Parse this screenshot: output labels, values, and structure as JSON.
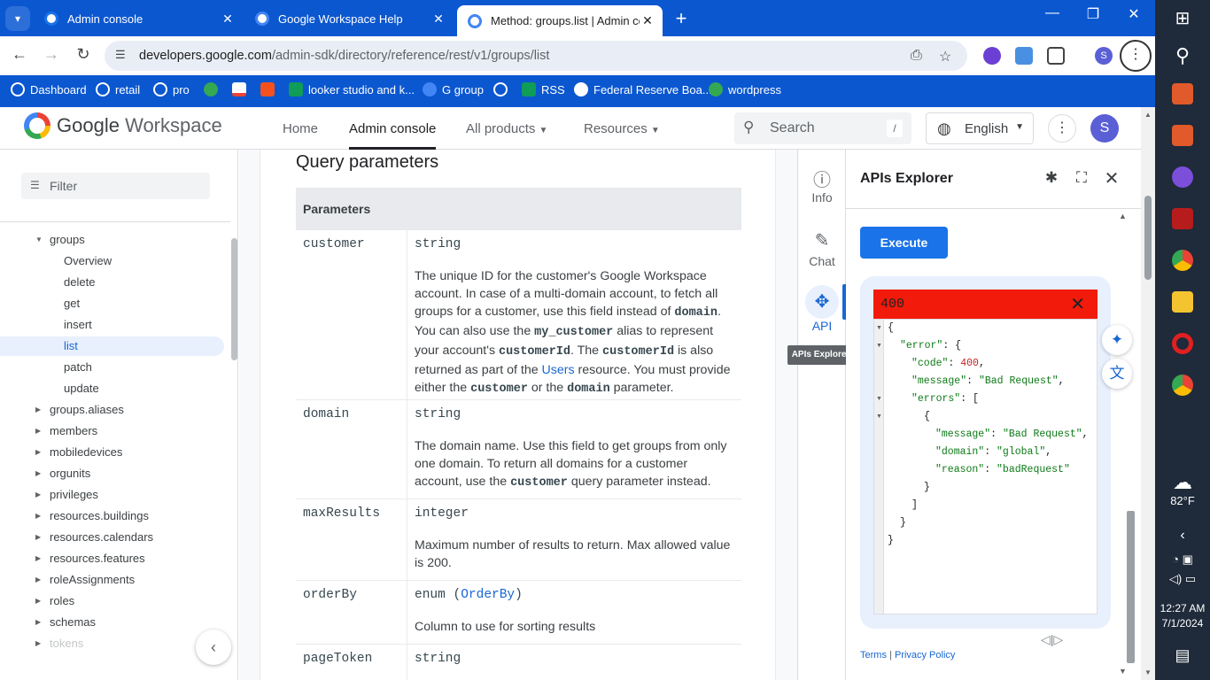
{
  "browser": {
    "tabs": [
      {
        "title": "Admin console",
        "favicon_color": "#1a73e8"
      },
      {
        "title": "Google Workspace Help",
        "favicon_color": "#4285f4"
      },
      {
        "title": "Method: groups.list  |  Admin co",
        "favicon_color": "#4285f4"
      }
    ],
    "url_domain": "developers.google.com",
    "url_path": "/admin-sdk/directory/reference/rest/v1/groups/list",
    "profile_letter": "S",
    "bookmarks": [
      {
        "label": "Dashboard",
        "color": "#ffffff"
      },
      {
        "label": "retail",
        "color": "#ffffff"
      },
      {
        "label": "pro",
        "color": "#ffffff"
      },
      {
        "label": "",
        "color": "#34a853"
      },
      {
        "label": "",
        "color": "#ea4335"
      },
      {
        "label": "",
        "color": "#f4511e"
      },
      {
        "label": "looker studio and k...",
        "color": "#0f9d58"
      },
      {
        "label": "G group",
        "color": "#4285f4"
      },
      {
        "label": "",
        "color": "#202124"
      },
      {
        "label": "RSS",
        "color": "#0f9d58"
      },
      {
        "label": "Federal Reserve Boa...",
        "color": "#ffffff"
      },
      {
        "label": "wordpress",
        "color": "#34a853"
      }
    ]
  },
  "header": {
    "logo_google": "Google",
    "logo_workspace": "Workspace",
    "nav": [
      "Home",
      "Admin console",
      "All products",
      "Resources"
    ],
    "search_placeholder": "Search",
    "search_shortcut": "/",
    "language": "English",
    "avatar_letter": "S"
  },
  "leftnav": {
    "filter_placeholder": "Filter",
    "group_label": "groups",
    "children": [
      "Overview",
      "delete",
      "get",
      "insert",
      "list",
      "patch",
      "update"
    ],
    "sections": [
      "groups.aliases",
      "members",
      "mobiledevices",
      "orgunits",
      "privileges",
      "resources.buildings",
      "resources.calendars",
      "resources.features",
      "roleAssignments",
      "roles",
      "schemas",
      "tokens"
    ]
  },
  "content": {
    "section_title": "Query parameters",
    "table_header": "Parameters",
    "params": {
      "customer": {
        "name": "customer",
        "type": "string",
        "desc": {
          "l1": "The unique ID for the customer's Google Workspace",
          "l2": "account. In case of a multi-domain account, to fetch all",
          "l3a": "groups for a customer, use this field instead of ",
          "l3code": "domain",
          "l3b": ".",
          "l4a": "You can also use the ",
          "l4code": "my_customer",
          "l4b": " alias to represent",
          "l5a": "your account's ",
          "l5code1": "customerId",
          "l5b": ". The ",
          "l5code2": "customerId",
          "l5c": " is also",
          "l6a": "returned as part of the ",
          "l6link": "Users",
          "l6b": " resource. You must provide",
          "l7a": "either the ",
          "l7code1": "customer",
          "l7b": " or the ",
          "l7code2": "domain",
          "l7c": " parameter."
        }
      },
      "domain": {
        "name": "domain",
        "type": "string",
        "desc": {
          "l1": "The domain name. Use this field to get groups from only",
          "l2": "one domain. To return all domains for a customer",
          "l3a": "account, use the ",
          "l3code": "customer",
          "l3b": " query parameter instead."
        }
      },
      "maxResults": {
        "name": "maxResults",
        "type": "integer",
        "desc": {
          "l1": "Maximum number of results to return. Max allowed value",
          "l2": "is 200."
        }
      },
      "orderBy": {
        "name": "orderBy",
        "type_prefix": "enum (",
        "type_link": "OrderBy",
        "type_suffix": ")",
        "desc": {
          "l1": "Column to use for sorting results"
        }
      },
      "pageToken": {
        "name": "pageToken",
        "type": "string"
      }
    }
  },
  "rail": {
    "info": "Info",
    "chat": "Chat",
    "api": "API",
    "tooltip": "APIs Explorer"
  },
  "explorer": {
    "title": "APIs Explorer",
    "execute": "Execute",
    "status_code": "400",
    "json": {
      "open": "{",
      "error_key": "\"error\"",
      "code_key": "\"code\"",
      "code_val": "400",
      "message_key": "\"message\"",
      "message_val": "\"Bad Request\"",
      "errors_key": "\"errors\"",
      "inner_message_key": "\"message\"",
      "inner_message_val": "\"Bad Request\"",
      "domain_key": "\"domain\"",
      "domain_val": "\"global\"",
      "reason_key": "\"reason\"",
      "reason_val": "\"badRequest\""
    },
    "footer_terms": "Terms",
    "footer_sep": "|",
    "footer_privacy": "Privacy Policy"
  },
  "taskbar": {
    "weather_temp": "82°F",
    "time": "12:27 AM",
    "date": "7/1/2024"
  }
}
